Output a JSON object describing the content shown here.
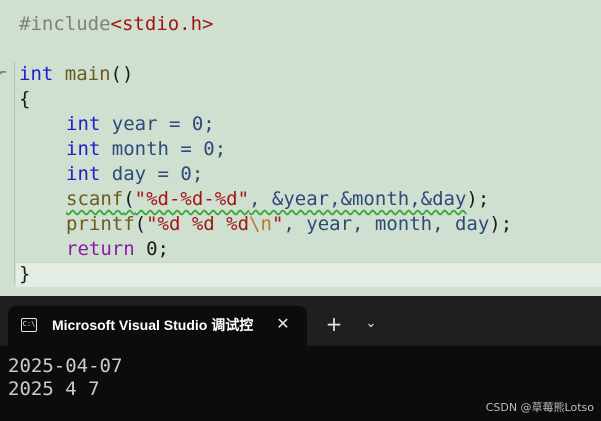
{
  "editor": {
    "line_include": {
      "directive": "#include",
      "header": "<stdio.h>"
    },
    "line_main": {
      "type": "int",
      "name": "main",
      "parens": "()"
    },
    "brace_open": "{",
    "decl_year": {
      "type": "int",
      "rest": " year = 0;"
    },
    "decl_month": {
      "type": "int",
      "rest": " month = 0;"
    },
    "decl_day": {
      "type": "int",
      "rest": " day = 0;"
    },
    "scanf": {
      "fn": "scanf",
      "open": "(",
      "fmt": "\"%d-%d-%d\"",
      "args": ", &year,&month,&day",
      "close": ");"
    },
    "printf": {
      "fn": "printf",
      "open": "(",
      "fmt1": "\"%d %d %d",
      "esc": "\\n",
      "fmt2": "\"",
      "args": ", year, month, day",
      "close": ");"
    },
    "ret": {
      "kw": "return",
      "rest": " 0;"
    },
    "brace_close": "}"
  },
  "terminal": {
    "tab_icon": "terminal-icon",
    "tab_icon_text": "C:\\",
    "tab_title": "Microsoft Visual Studio 调试控",
    "close_glyph": "✕",
    "new_tab_glyph": "+",
    "dropdown_glyph": "⌄",
    "output": [
      "2025-04-07",
      "2025 4 7"
    ]
  },
  "watermark": "CSDN @草莓熊Lotso",
  "colors": {
    "editor_bg": "#cfdfd0",
    "terminal_bg": "#0c0c0c",
    "keyword": "#2020c8",
    "string": "#a31515"
  }
}
